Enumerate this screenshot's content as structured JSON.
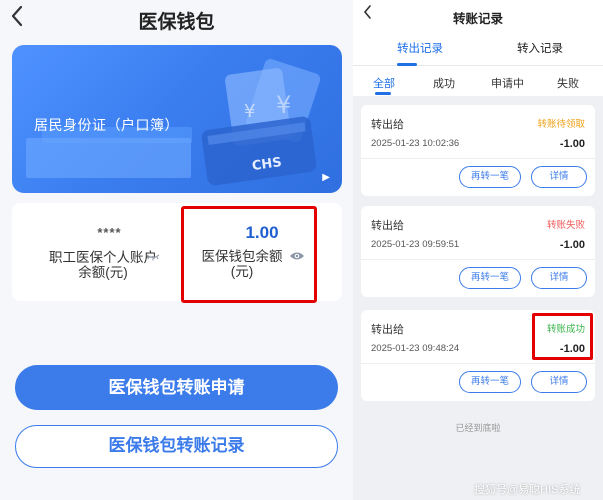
{
  "left": {
    "title": "医保钱包",
    "back_icon": "chevron-left-icon",
    "card": {
      "label": "居民身份证（户口簿）",
      "logo_text": "CHS"
    },
    "personal": {
      "masked": "****",
      "label": "职工医保个人账户余额(元)"
    },
    "wallet": {
      "value": "1.00",
      "label": "医保钱包余额(元)"
    },
    "buttons": {
      "apply": "医保钱包转账申请",
      "records": "医保钱包转账记录"
    }
  },
  "right": {
    "title": "转账记录",
    "back_icon": "chevron-left-icon",
    "tabs": [
      "转出记录",
      "转入记录"
    ],
    "filters": [
      "全部",
      "成功",
      "申请中",
      "失败"
    ],
    "records": [
      {
        "to": "转出给",
        "status": "转账待领取",
        "status_color": "#f0a21b",
        "time": "2025-01-23 10:02:36",
        "amount": "-1.00",
        "btn1": "再转一笔",
        "btn2": "详情"
      },
      {
        "to": "转出给",
        "status": "转账失败",
        "status_color": "#f05a5a",
        "time": "2025-01-23 09:59:51",
        "amount": "-1.00",
        "btn1": "再转一笔",
        "btn2": "详情"
      },
      {
        "to": "转出给",
        "status": "转账成功",
        "status_color": "#3cb44b",
        "time": "2025-01-23 09:48:24",
        "amount": "-1.00",
        "btn1": "再转一笔",
        "btn2": "详情"
      }
    ],
    "end_text": "已经到底啦"
  },
  "watermark": "搜狐号@易聪HIS系统",
  "colors": {
    "brand": "#3b7bea",
    "highlight": "#e30000"
  }
}
